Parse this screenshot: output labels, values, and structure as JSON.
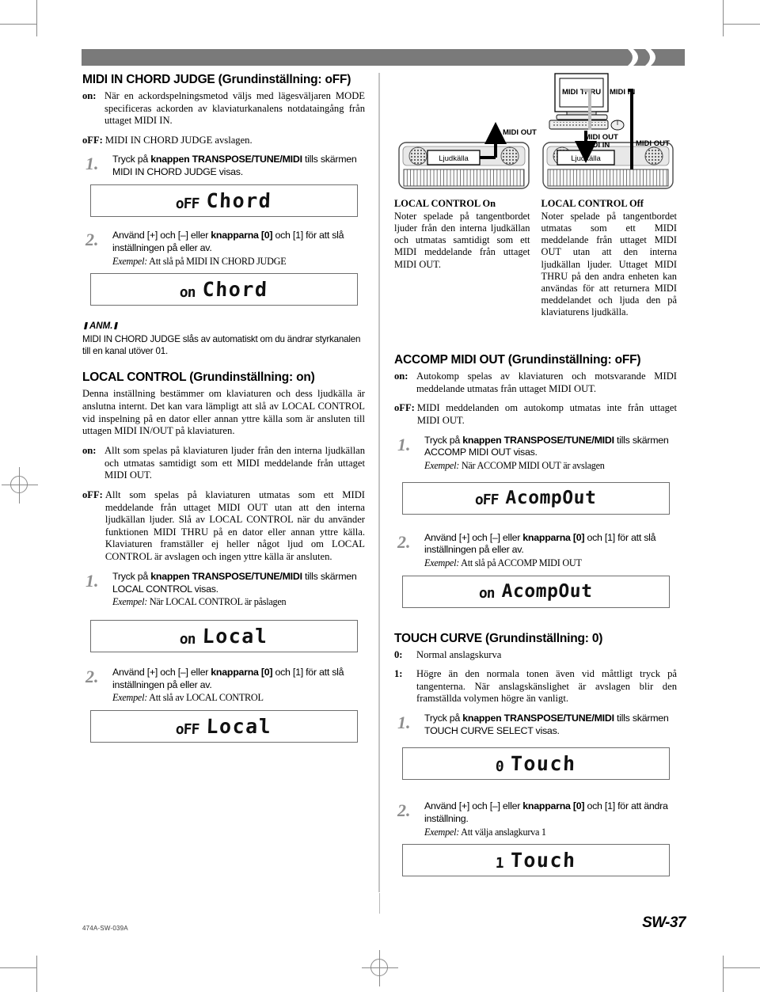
{
  "page": {
    "footer_code": "474A-SW-039A",
    "page_number": "SW-37"
  },
  "left_column": {
    "section1": {
      "heading": "MIDI IN CHORD JUDGE (Grundinställning: oFF)",
      "defs": [
        {
          "term": "on:",
          "desc": "När en ackordspelningsmetod väljs med lägesväljaren MODE specificeras ackorden av klaviaturkanalens notdataingång från uttaget MIDI IN."
        },
        {
          "term": "oFF:",
          "desc": "MIDI IN CHORD JUDGE avslagen."
        }
      ],
      "step1": {
        "num": "1.",
        "text_pre": "Tryck på ",
        "text_bold": "knappen TRANSPOSE/TUNE/MIDI",
        "text_post": " tills skärmen MIDI IN CHORD JUDGE visas."
      },
      "lcd1": {
        "value": "oFF",
        "word": "Chord"
      },
      "step2": {
        "num": "2.",
        "text_pre": "Använd [+] och [–] eller ",
        "text_bold": "knapparna [0]",
        "text_post": " och [1] för att slå inställningen på eller av.",
        "example_label": "Exempel:",
        "example_text": " Att slå på MIDI IN CHORD JUDGE"
      },
      "lcd2": {
        "value": "on",
        "word": "Chord"
      }
    },
    "note": {
      "title": "ANM.",
      "body": "MIDI IN CHORD JUDGE slås av automatiskt om du ändrar styrkanalen till en kanal utöver 01."
    },
    "section2": {
      "heading": "LOCAL CONTROL (Grundinställning: on)",
      "intro": "Denna inställning bestämmer om klaviaturen och dess ljudkälla är anslutna internt. Det kan vara lämpligt att slå av LOCAL CONTROL vid inspelning på en dator eller annan yttre källa som är ansluten till uttagen MIDI IN/OUT på klaviaturen.",
      "defs": [
        {
          "term": "on:",
          "desc": "Allt som spelas på klaviaturen ljuder från den interna ljudkällan och utmatas samtidigt som ett MIDI meddelande från uttaget MIDI OUT."
        },
        {
          "term": "oFF:",
          "desc": "Allt som spelas på klaviaturen utmatas som ett MIDI meddelande från uttaget MIDI OUT utan att den interna ljudkällan ljuder. Slå av LOCAL CONTROL när du använder funktionen MIDI THRU på en dator eller annan yttre källa. Klaviaturen framställer ej heller något ljud om LOCAL CONTROL är avslagen och ingen yttre källa är ansluten."
        }
      ],
      "step1": {
        "num": "1.",
        "text_pre": "Tryck på ",
        "text_bold": "knappen TRANSPOSE/TUNE/MIDI",
        "text_post": " tills skärmen LOCAL CONTROL visas.",
        "example_label": "Exempel:",
        "example_text": " När LOCAL CONTROL är påslagen"
      },
      "lcd1": {
        "value": "on",
        "word": "Local"
      },
      "step2": {
        "num": "2.",
        "text_pre": "Använd [+] och [–] eller ",
        "text_bold": "knapparna [0]",
        "text_post": " och [1] för att slå inställningen på eller av.",
        "example_label": "Exempel:",
        "example_text": " Att slå av LOCAL CONTROL"
      },
      "lcd2": {
        "value": "oFF",
        "word": "Local"
      }
    }
  },
  "right_column": {
    "diagram": {
      "left_keyboard": {
        "sound_source_label": "Ljudkälla",
        "midi_out_label": "MIDI OUT"
      },
      "right_keyboard": {
        "sound_source_label": "Ljudkälla",
        "computer_screen_label": "MIDI THRU",
        "midi_in_top_label": "MIDI IN",
        "midi_out_mid_label": "MIDI OUT",
        "midi_in_mid_label": "MIDI IN",
        "midi_out_right_label": "MIDI OUT"
      }
    },
    "captions": [
      {
        "title": "LOCAL CONTROL On",
        "text": "Noter spelade på tangentbordet ljuder från den interna ljudkällan och utmatas samtidigt som ett MIDI meddelande från uttaget MIDI OUT."
      },
      {
        "title": "LOCAL CONTROL Off",
        "text": "Noter spelade på tangentbordet utmatas som ett MIDI meddelande från uttaget MIDI OUT utan att den interna ljudkällan ljuder. Uttaget MIDI THRU på den andra enheten kan användas för att returnera MIDI meddelandet och ljuda den på klaviaturens ljudkälla."
      }
    ],
    "section1": {
      "heading": "ACCOMP MIDI OUT (Grundinställning: oFF)",
      "defs": [
        {
          "term": "on:",
          "desc": "Autokomp spelas av klaviaturen och motsvarande MIDI meddelande utmatas från uttaget MIDI OUT."
        },
        {
          "term": "oFF:",
          "desc": "MIDI meddelanden om autokomp utmatas inte från uttaget MIDI OUT."
        }
      ],
      "step1": {
        "num": "1.",
        "text_pre": "Tryck på ",
        "text_bold": "knappen TRANSPOSE/TUNE/MIDI",
        "text_post": " tills skärmen ACCOMP MIDI OUT visas.",
        "example_label": "Exempel:",
        "example_text": " När ACCOMP MIDI OUT är avslagen"
      },
      "lcd1": {
        "value": "oFF",
        "word": "AcompOut"
      },
      "step2": {
        "num": "2.",
        "text_pre": "Använd [+] och [–] eller ",
        "text_bold": "knapparna [0]",
        "text_post": " och [1] för att slå inställningen på eller av.",
        "example_label": "Exempel:",
        "example_text": " Att slå på ACCOMP MIDI OUT"
      },
      "lcd2": {
        "value": "on",
        "word": "AcompOut"
      }
    },
    "section2": {
      "heading": "TOUCH CURVE (Grundinställning: 0)",
      "defs": [
        {
          "term": "0:",
          "desc": "Normal anslagskurva"
        },
        {
          "term": "1:",
          "desc": "Högre än den normala tonen även vid måttligt tryck på tangenterna. När anslagskänslighet är avslagen blir den framställda volymen högre än vanligt."
        }
      ],
      "step1": {
        "num": "1.",
        "text_pre": "Tryck på ",
        "text_bold": "knappen TRANSPOSE/TUNE/MIDI",
        "text_post": " tills skärmen TOUCH CURVE SELECT visas."
      },
      "lcd1": {
        "value": "0",
        "word": "Touch"
      },
      "step2": {
        "num": "2.",
        "text_pre": "Använd [+] och [–] eller ",
        "text_bold": "knapparna [0]",
        "text_post": " och [1] för att ändra inställning.",
        "example_label": "Exempel:",
        "example_text": " Att välja anslagkurva 1"
      },
      "lcd2": {
        "value": "1",
        "word": "Touch"
      }
    }
  },
  "colors": {
    "header_bar": "#7a7a7a",
    "step_number": "#8e8e8e",
    "divider": "#c4c4c4",
    "crop_mark": "#8a8a8a"
  }
}
